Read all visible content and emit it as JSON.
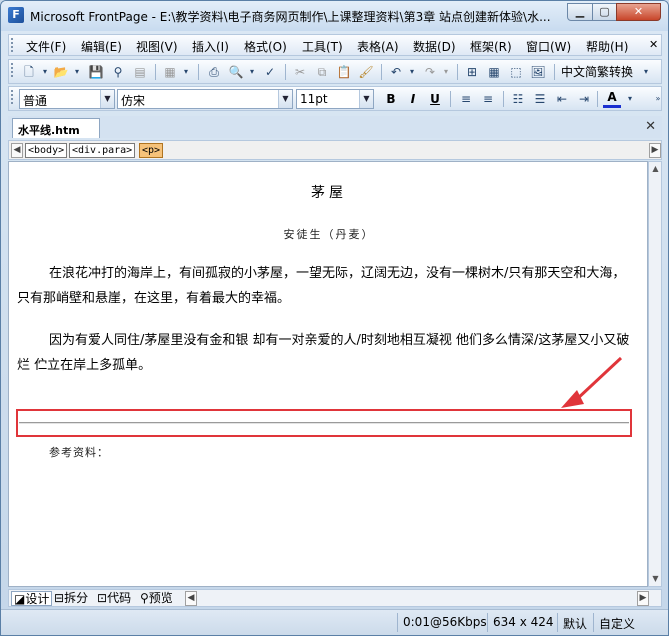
{
  "window": {
    "title": "Microsoft FrontPage - E:\\教学资料\\电子商务网页制作\\上课整理资料\\第3章 站点创建新体验\\水..."
  },
  "menu": [
    "文件(F)",
    "编辑(E)",
    "视图(V)",
    "插入(I)",
    "格式(O)",
    "工具(T)",
    "表格(A)",
    "数据(D)",
    "框架(R)",
    "窗口(W)",
    "帮助(H)"
  ],
  "toolbar1": {
    "lang_label": "中文简繁转换"
  },
  "toolbar2": {
    "style_value": "普通",
    "font_value": "仿宋",
    "size_value": "11pt",
    "bold": "B",
    "italic": "I",
    "underline": "U",
    "font_color_letter": "A"
  },
  "document_tab": {
    "label": "水平线.htm"
  },
  "tag_selector": [
    "<body>",
    "<div.para>",
    "<p>"
  ],
  "page": {
    "title": "茅屋",
    "author": "安徒生（丹麦）",
    "paragraph1": "在浪花冲打的海岸上，有间孤寂的小茅屋，一望无际，辽阔无边，没有一棵树木/只有那天空和大海，只有那峭壁和悬崖，在这里，有着最大的幸福。",
    "paragraph2": "因为有爱人同住/茅屋里没有金和银 却有一对亲爱的人/时刻地相互凝视 他们多么情深/这茅屋又小又破烂 伫立在岸上多孤单。",
    "references": "参考资料："
  },
  "view_tabs": [
    "设计",
    "拆分",
    "代码",
    "预览"
  ],
  "status": {
    "speed": "0:01@56Kbps",
    "dimensions": "634 x 424",
    "mode": "默认",
    "custom": "自定义"
  },
  "colors": {
    "highlight": "#e0353a",
    "annotation_arrow": "#e0353a"
  }
}
